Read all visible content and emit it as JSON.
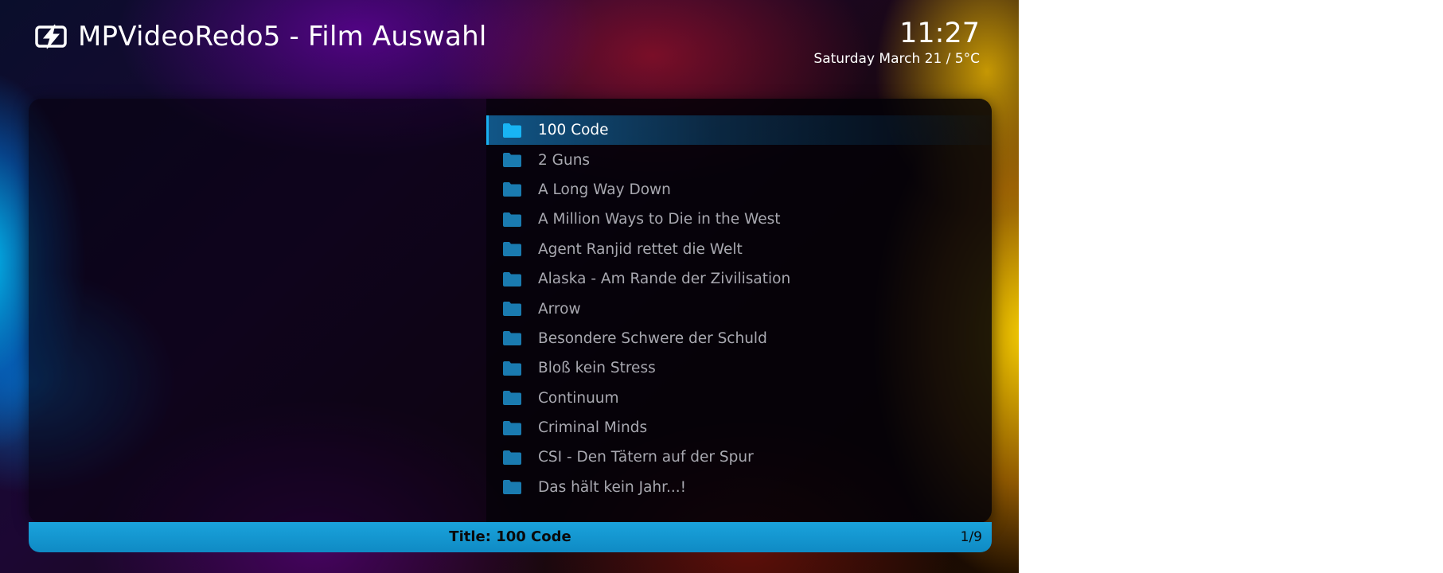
{
  "header": {
    "logo_icon": "lightning-bolt-icon",
    "title": "MPVideoRedo5 - Film Auswahl"
  },
  "clock": {
    "time": "11:27",
    "date": "Saturday March 21 / 5°C"
  },
  "list": {
    "item_icon": "folder-icon",
    "selected_index": 0,
    "items": [
      {
        "label": "100 Code"
      },
      {
        "label": "2 Guns"
      },
      {
        "label": "A Long Way Down"
      },
      {
        "label": "A Million Ways to Die in the West"
      },
      {
        "label": "Agent Ranjid rettet die Welt"
      },
      {
        "label": "Alaska - Am Rande der Zivilisation"
      },
      {
        "label": "Arrow"
      },
      {
        "label": "Besondere Schwere der Schuld"
      },
      {
        "label": "Bloß kein Stress"
      },
      {
        "label": "Continuum"
      },
      {
        "label": "Criminal Minds"
      },
      {
        "label": "CSI - Den Tätern auf der Spur"
      },
      {
        "label": "Das hält kein Jahr...!"
      }
    ]
  },
  "status": {
    "title": "Title: 100 Code",
    "page": "1/9"
  },
  "colors": {
    "accent": "#19b0f2",
    "folder_selected": "#18b4f4",
    "folder": "#1a7bb0",
    "item_text": "#a8a8b0",
    "status_bar": "#1aa3dc"
  }
}
